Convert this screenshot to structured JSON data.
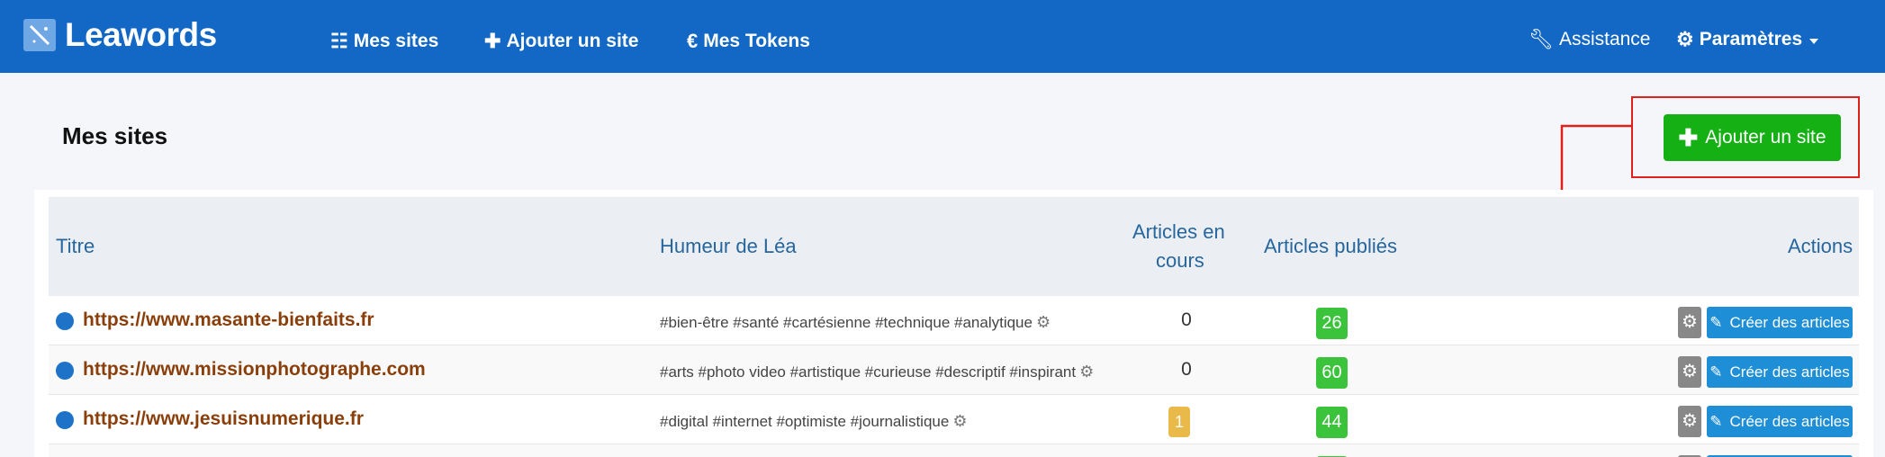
{
  "navbar": {
    "brand": "Leawords",
    "items": [
      {
        "label": "Mes sites",
        "icon": "list-icon"
      },
      {
        "label": "Ajouter un site",
        "icon": "plus-icon"
      },
      {
        "label": "Mes Tokens",
        "icon": "euro-icon"
      }
    ],
    "assistance": "Assistance",
    "settings": "Paramètres"
  },
  "page": {
    "title": "Mes sites",
    "add_button": "Ajouter un site"
  },
  "table": {
    "headers": {
      "titre": "Titre",
      "humeur": "Humeur de Léa",
      "articles_en_cours_1": "Articles en",
      "articles_en_cours_2": "cours",
      "articles_publies": "Articles publiés",
      "actions": "Actions"
    },
    "rows": [
      {
        "site": "https://www.masante-bienfaits.fr",
        "mood": "#bien-être #santé #cartésienne #technique #analytique",
        "en_cours": "0",
        "en_cours_badge": false,
        "publies": "26",
        "action": "Créer des articles"
      },
      {
        "site": "https://www.missionphotographe.com",
        "mood": "#arts #photo video #artistique #curieuse #descriptif #inspirant",
        "en_cours": "0",
        "en_cours_badge": false,
        "publies": "60",
        "action": "Créer des articles"
      },
      {
        "site": "https://www.jesuisnumerique.fr",
        "mood": "#digital #internet #optimiste #journalistique",
        "en_cours": "1",
        "en_cours_badge": true,
        "publies": "44",
        "action": "Créer des articles"
      }
    ]
  },
  "colors": {
    "navbar": "#1268c4",
    "add_button": "#14b014",
    "site_link": "#8a3f0b",
    "header_text": "#27669c",
    "annotation": "#e0201b"
  }
}
